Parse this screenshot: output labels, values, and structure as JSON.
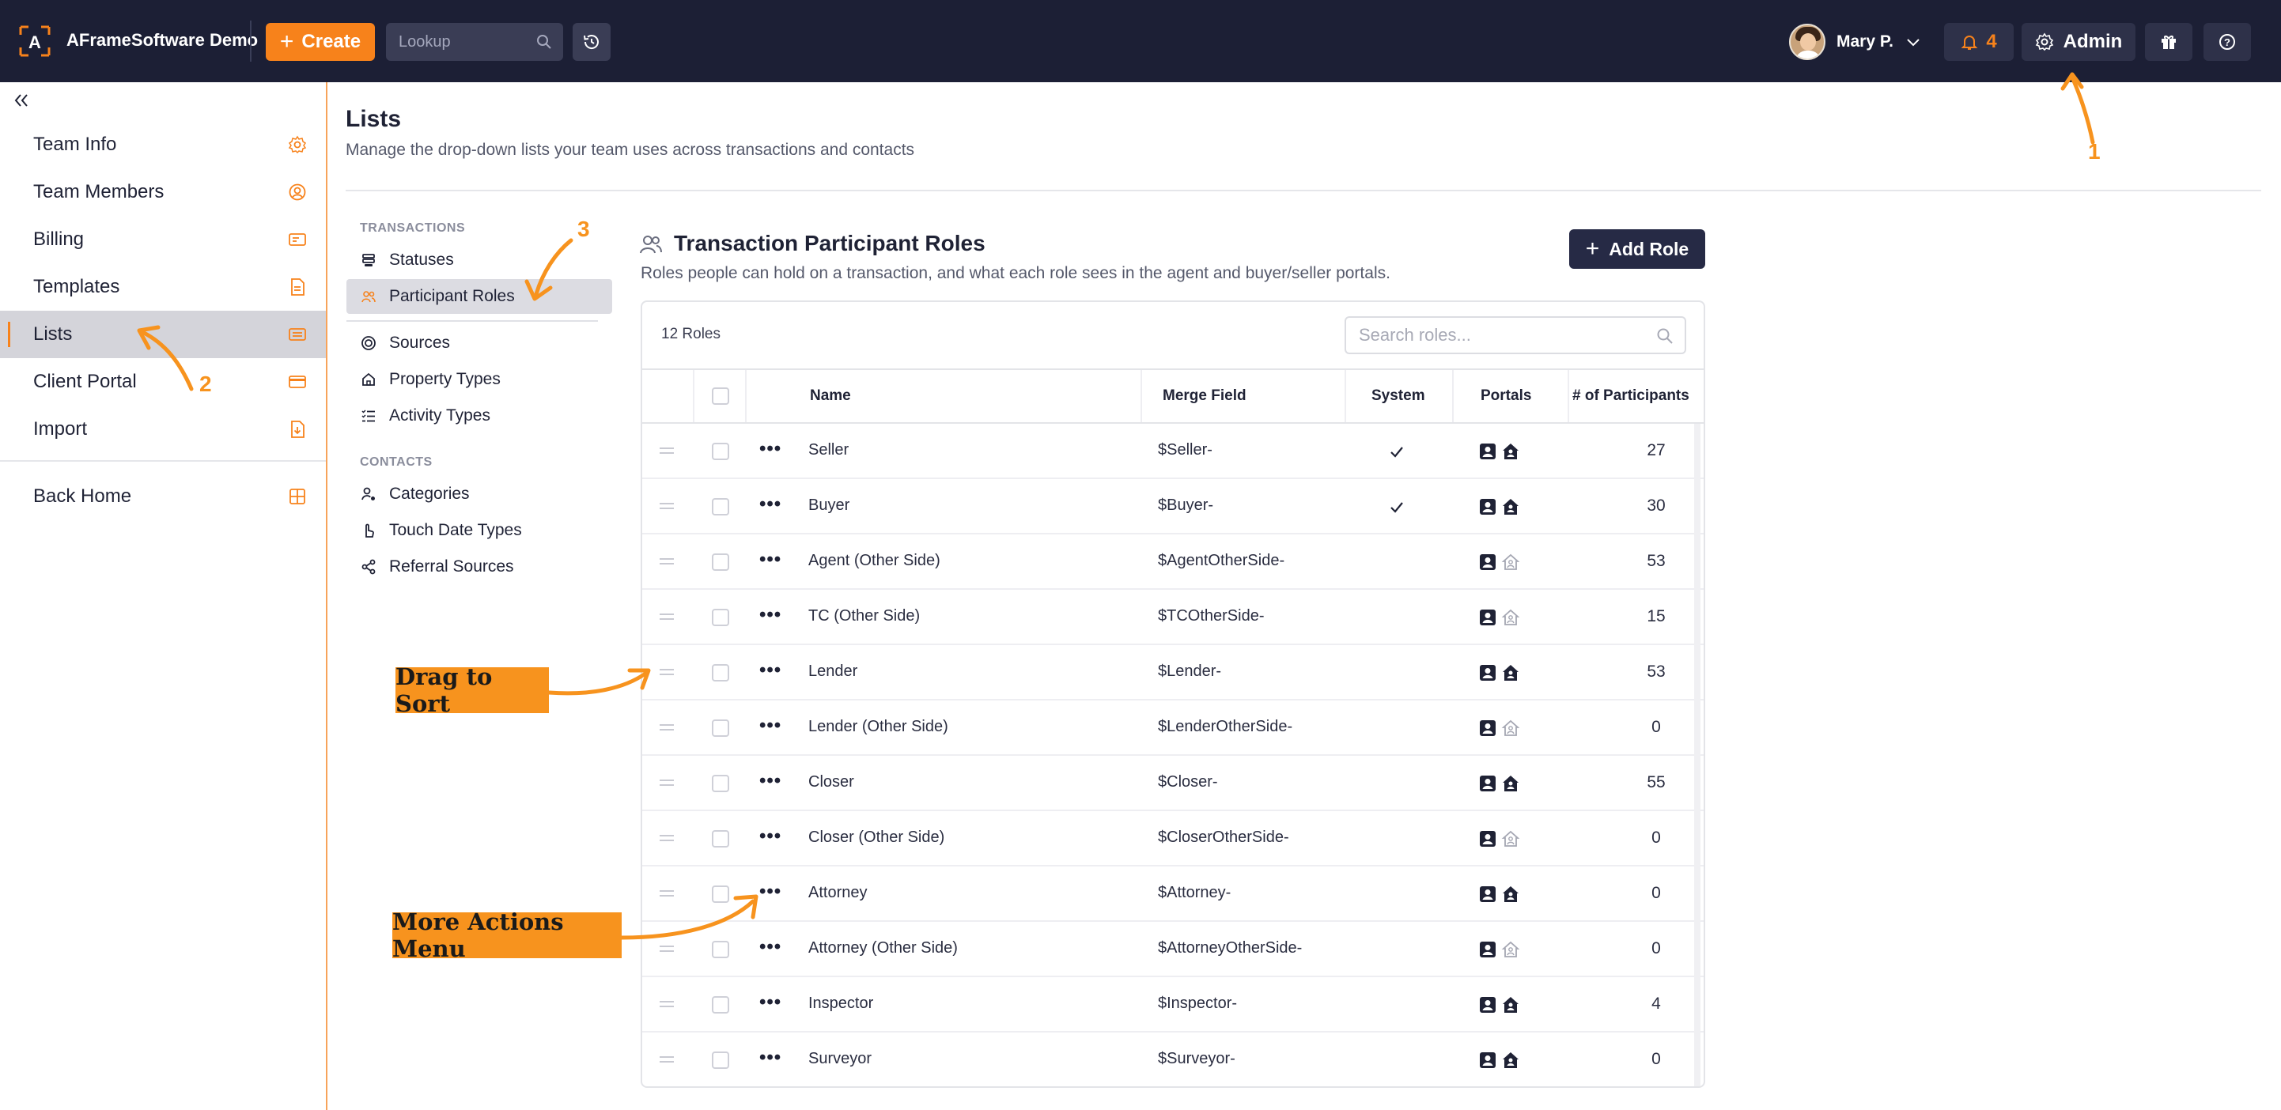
{
  "topbar": {
    "brand": "AFrameSoftware Demo",
    "create_label": "Create",
    "lookup_placeholder": "Lookup",
    "user_name": "Mary P.",
    "notification_count": "4",
    "admin_label": "Admin",
    "icons": [
      "logo-icon",
      "plus-icon",
      "search-icon",
      "history-icon",
      "avatar",
      "chevron-down-icon",
      "bell-icon",
      "gear-icon",
      "gift-icon",
      "help-icon"
    ]
  },
  "sidebar": {
    "items": [
      {
        "label": "Team Info",
        "icon": "gear-icon"
      },
      {
        "label": "Team Members",
        "icon": "user-circle-icon"
      },
      {
        "label": "Billing",
        "icon": "billing-icon"
      },
      {
        "label": "Templates",
        "icon": "document-icon"
      },
      {
        "label": "Lists",
        "icon": "list-icon",
        "active": true
      },
      {
        "label": "Client Portal",
        "icon": "card-icon"
      },
      {
        "label": "Import",
        "icon": "import-icon"
      }
    ],
    "back_home": "Back Home",
    "accent": "#f7821b"
  },
  "page": {
    "title": "Lists",
    "subtitle": "Manage the drop-down lists your team uses across transactions and contacts"
  },
  "subnav": {
    "transactions_heading": "TRANSACTIONS",
    "transactions": [
      "Statuses",
      "Participant Roles",
      "Sources",
      "Property Types",
      "Activity Types"
    ],
    "contacts_heading": "CONTACTS",
    "contacts": [
      "Categories",
      "Touch Date Types",
      "Referral Sources"
    ]
  },
  "roles": {
    "title": "Transaction Participant Roles",
    "description": "Roles people can hold on a transaction, and what each role sees in the agent and buyer/seller portals.",
    "add_label": "Add Role",
    "count_label": "12 Roles",
    "search_placeholder": "Search roles...",
    "columns": [
      "Name",
      "Merge Field",
      "System",
      "Portals",
      "# of Participants"
    ],
    "rows": [
      {
        "name": "Seller",
        "merge": "$Seller-",
        "system": true,
        "portal2_active": true,
        "participants": "27"
      },
      {
        "name": "Buyer",
        "merge": "$Buyer-",
        "system": true,
        "portal2_active": true,
        "participants": "30"
      },
      {
        "name": "Agent (Other Side)",
        "merge": "$AgentOtherSide-",
        "system": false,
        "portal2_active": false,
        "participants": "53"
      },
      {
        "name": "TC (Other Side)",
        "merge": "$TCOtherSide-",
        "system": false,
        "portal2_active": false,
        "participants": "15"
      },
      {
        "name": "Lender",
        "merge": "$Lender-",
        "system": false,
        "portal2_active": true,
        "participants": "53"
      },
      {
        "name": "Lender (Other Side)",
        "merge": "$LenderOtherSide-",
        "system": false,
        "portal2_active": false,
        "participants": "0"
      },
      {
        "name": "Closer",
        "merge": "$Closer-",
        "system": false,
        "portal2_active": true,
        "participants": "55"
      },
      {
        "name": "Closer (Other Side)",
        "merge": "$CloserOtherSide-",
        "system": false,
        "portal2_active": false,
        "participants": "0"
      },
      {
        "name": "Attorney",
        "merge": "$Attorney-",
        "system": false,
        "portal2_active": true,
        "participants": "0"
      },
      {
        "name": "Attorney (Other Side)",
        "merge": "$AttorneyOtherSide-",
        "system": false,
        "portal2_active": false,
        "participants": "0"
      },
      {
        "name": "Inspector",
        "merge": "$Inspector-",
        "system": false,
        "portal2_active": true,
        "participants": "4"
      },
      {
        "name": "Surveyor",
        "merge": "$Surveyor-",
        "system": false,
        "portal2_active": true,
        "participants": "0"
      }
    ]
  },
  "annotations": {
    "callouts": [
      "Drag to Sort",
      "More Actions Menu"
    ],
    "numbers": [
      "1",
      "2",
      "3"
    ],
    "color": "#f7931e"
  }
}
